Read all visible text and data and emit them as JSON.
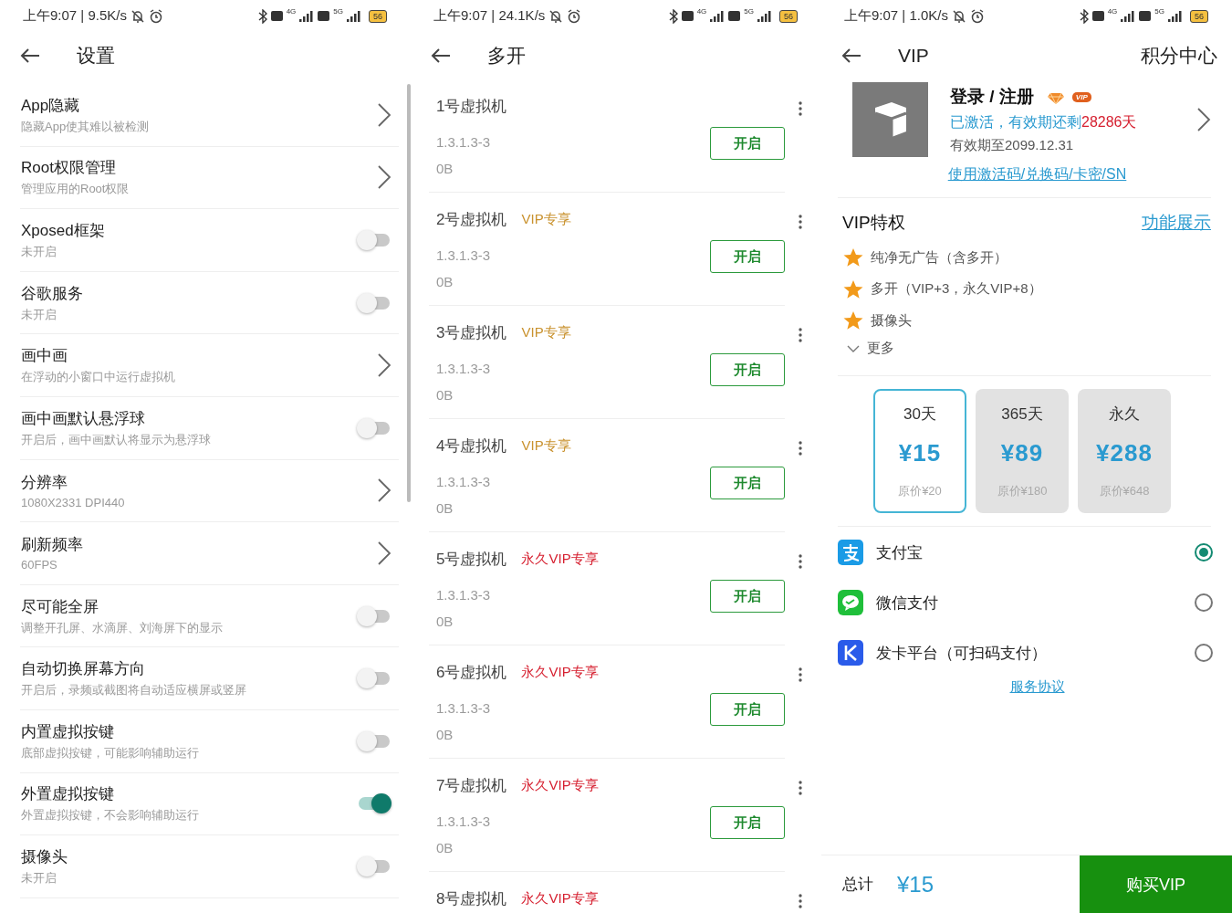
{
  "settings_screen": {
    "status_bar": {
      "time_speed": "上午9:07 | 9.5K/s",
      "network_1": "4G",
      "network_2": "5G",
      "battery": "56"
    },
    "title": "设置",
    "items": [
      {
        "kind": "link",
        "title": "App隐藏",
        "subtitle": "隐藏App使其难以被检测"
      },
      {
        "kind": "link",
        "title": "Root权限管理",
        "subtitle": "管理应用的Root权限"
      },
      {
        "kind": "switch",
        "title": "Xposed框架",
        "subtitle": "未开启",
        "on": false
      },
      {
        "kind": "switch",
        "title": "谷歌服务",
        "subtitle": "未开启",
        "on": false
      },
      {
        "kind": "link",
        "title": "画中画",
        "subtitle": "在浮动的小窗口中运行虚拟机"
      },
      {
        "kind": "switch",
        "title": "画中画默认悬浮球",
        "subtitle": "开启后，画中画默认将显示为悬浮球",
        "on": false
      },
      {
        "kind": "link",
        "title": "分辨率",
        "subtitle": "1080X2331 DPI440"
      },
      {
        "kind": "link",
        "title": "刷新频率",
        "subtitle": "60FPS"
      },
      {
        "kind": "switch",
        "title": "尽可能全屏",
        "subtitle": "调整开孔屏、水滴屏、刘海屏下的显示",
        "on": false
      },
      {
        "kind": "switch",
        "title": "自动切换屏幕方向",
        "subtitle": "开启后，录频或截图将自动适应横屏或竖屏",
        "on": false
      },
      {
        "kind": "switch",
        "title": "内置虚拟按键",
        "subtitle": "底部虚拟按键，可能影响辅助运行",
        "on": false
      },
      {
        "kind": "switch",
        "title": "外置虚拟按键",
        "subtitle": "外置虚拟按键，不会影响辅助运行",
        "on": true
      },
      {
        "kind": "switch",
        "title": "摄像头",
        "subtitle": "未开启",
        "on": false
      }
    ]
  },
  "multi_open_screen": {
    "status_bar": {
      "time_speed": "上午9:07 | 24.1K/s",
      "network_1": "4G",
      "network_2": "5G",
      "battery": "56"
    },
    "title": "多开",
    "machines": [
      {
        "name": "1号虚拟机",
        "version": "1.3.1.3-3",
        "size": "0B",
        "button": "开启"
      },
      {
        "name": "2号虚拟机",
        "tag": {
          "text": "VIP专享",
          "kind": "vip"
        },
        "version": "1.3.1.3-3",
        "size": "0B",
        "button": "开启"
      },
      {
        "name": "3号虚拟机",
        "tag": {
          "text": "VIP专享",
          "kind": "vip"
        },
        "version": "1.3.1.3-3",
        "size": "0B",
        "button": "开启"
      },
      {
        "name": "4号虚拟机",
        "tag": {
          "text": "VIP专享",
          "kind": "vip"
        },
        "version": "1.3.1.3-3",
        "size": "0B",
        "button": "开启"
      },
      {
        "name": "5号虚拟机",
        "tag": {
          "text": "永久VIP专享",
          "kind": "lifetime"
        },
        "version": "1.3.1.3-3",
        "size": "0B",
        "button": "开启"
      },
      {
        "name": "6号虚拟机",
        "tag": {
          "text": "永久VIP专享",
          "kind": "lifetime"
        },
        "version": "1.3.1.3-3",
        "size": "0B",
        "button": "开启"
      },
      {
        "name": "7号虚拟机",
        "tag": {
          "text": "永久VIP专享",
          "kind": "lifetime"
        },
        "version": "1.3.1.3-3",
        "size": "0B",
        "button": "开启"
      },
      {
        "name": "8号虚拟机",
        "tag": {
          "text": "永久VIP专享",
          "kind": "lifetime"
        }
      }
    ]
  },
  "vip_screen": {
    "status_bar": {
      "time_speed": "上午9:07 | 1.0K/s",
      "network_1": "4G",
      "network_2": "5G",
      "battery": "56"
    },
    "title": "VIP",
    "action": "积分中心",
    "profile": {
      "name": "登录 / 注册",
      "badge": "VIP",
      "status": "已激活，有效期还剩",
      "remaining": "28286天",
      "expiry": "有效期至2099.12.31",
      "redeem_link": "使用激活码/兑换码/卡密/SN"
    },
    "perks": {
      "title": "VIP特权",
      "link": "功能展示",
      "items": [
        "纯净无广告（含多开）",
        "多开（VIP+3，永久VIP+8）",
        "摄像头"
      ],
      "more": "更多"
    },
    "plans": [
      {
        "duration": "30天",
        "price": "¥15",
        "original": "原价¥20",
        "selected": true
      },
      {
        "duration": "365天",
        "price": "¥89",
        "original": "原价¥180",
        "selected": false
      },
      {
        "duration": "永久",
        "price": "¥288",
        "original": "原价¥648",
        "selected": false
      }
    ],
    "payments": [
      {
        "kind": "alipay",
        "name": "支付宝",
        "selected": true
      },
      {
        "kind": "wechat",
        "name": "微信支付",
        "selected": false
      },
      {
        "kind": "card",
        "name": "发卡平台（可扫码支付）",
        "selected": false
      }
    ],
    "agreement": "服务协议",
    "footer": {
      "total_label": "总计",
      "total": "¥15",
      "buy": "购买VIP"
    }
  }
}
